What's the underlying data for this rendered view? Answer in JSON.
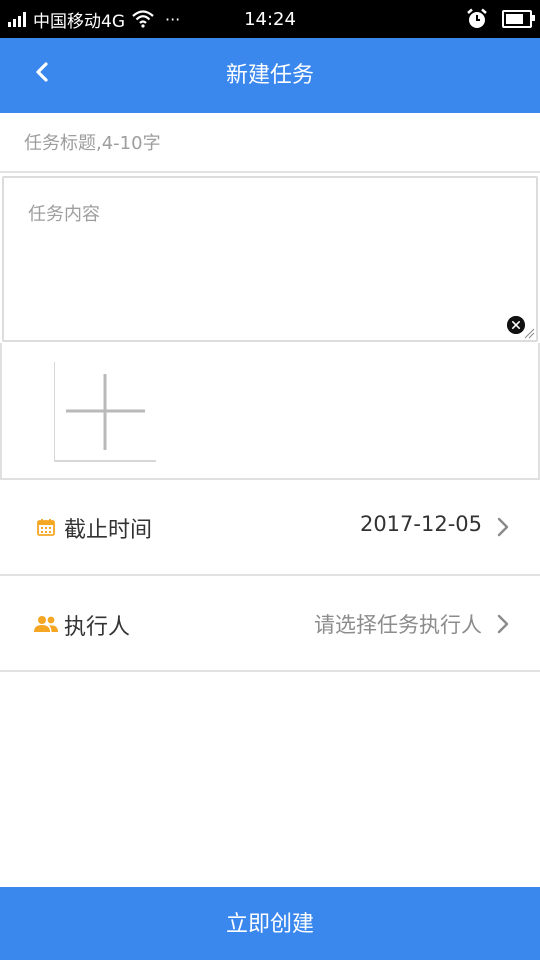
{
  "status_bar": {
    "carrier": "中国移动4G",
    "more": "···",
    "time": "14:24",
    "battery_level": 0.65
  },
  "header": {
    "title": "新建任务",
    "back_icon": "chevron-left-icon"
  },
  "form": {
    "title_placeholder": "任务标题,4-10字",
    "title_value": "",
    "content_placeholder": "任务内容",
    "content_value": "",
    "clear_icon": "close-circle-icon",
    "add_image_icon": "plus-icon"
  },
  "deadline": {
    "icon": "calendar-icon",
    "label": "截止时间",
    "value": "2017-12-05"
  },
  "assignee": {
    "icon": "people-icon",
    "label": "执行人",
    "value": "请选择任务执行人"
  },
  "submit": {
    "label": "立即创建"
  },
  "colors": {
    "primary": "#3a87ee",
    "accent_icon": "#f5a623"
  }
}
